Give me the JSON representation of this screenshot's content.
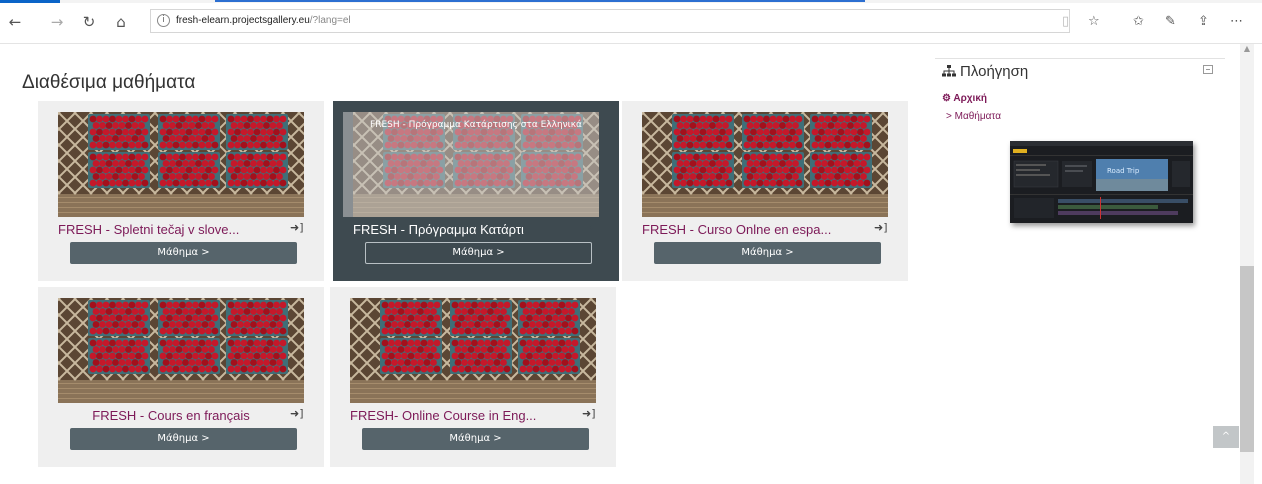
{
  "browser": {
    "url_host": "fresh-elearn.projectsgallery.eu",
    "url_rest": "/?lang=el",
    "icons": [
      "back-icon",
      "forward-icon",
      "refresh-icon",
      "home-icon",
      "reading-view-icon",
      "favorite-icon",
      "favorites-list-icon",
      "notes-icon",
      "share-icon",
      "more-icon"
    ]
  },
  "page": {
    "title": "Διαθέσιμα μαθήματα"
  },
  "courses": [
    {
      "title": "FRESH - Spletni tečaj v slove...",
      "button": "Μάθημα >"
    },
    {
      "title": "FRESH - Πρόγραμμα Κατάρτι",
      "button": "Μάθημα >",
      "overlay": "FRESH - Πρόγραμμα Κατάρτισης στα Ελληνικά"
    },
    {
      "title": "FRESH - Curso Onlne en espa...",
      "button": "Μάθημα >"
    },
    {
      "title": "FRESH - Cours en français",
      "button": "Μάθημα >"
    },
    {
      "title": "FRESH- Online Course in Eng...",
      "button": "Μάθημα >"
    }
  ],
  "sidebar": {
    "heading": "Πλοήγηση",
    "home": "Αρχική",
    "courses": "Μαθήματα",
    "video_caption": "Road Trip"
  },
  "colors": {
    "link": "#7d1a58",
    "button": "#56646b",
    "card_bg": "#efefef",
    "active_card_bg": "#3e4a50"
  }
}
